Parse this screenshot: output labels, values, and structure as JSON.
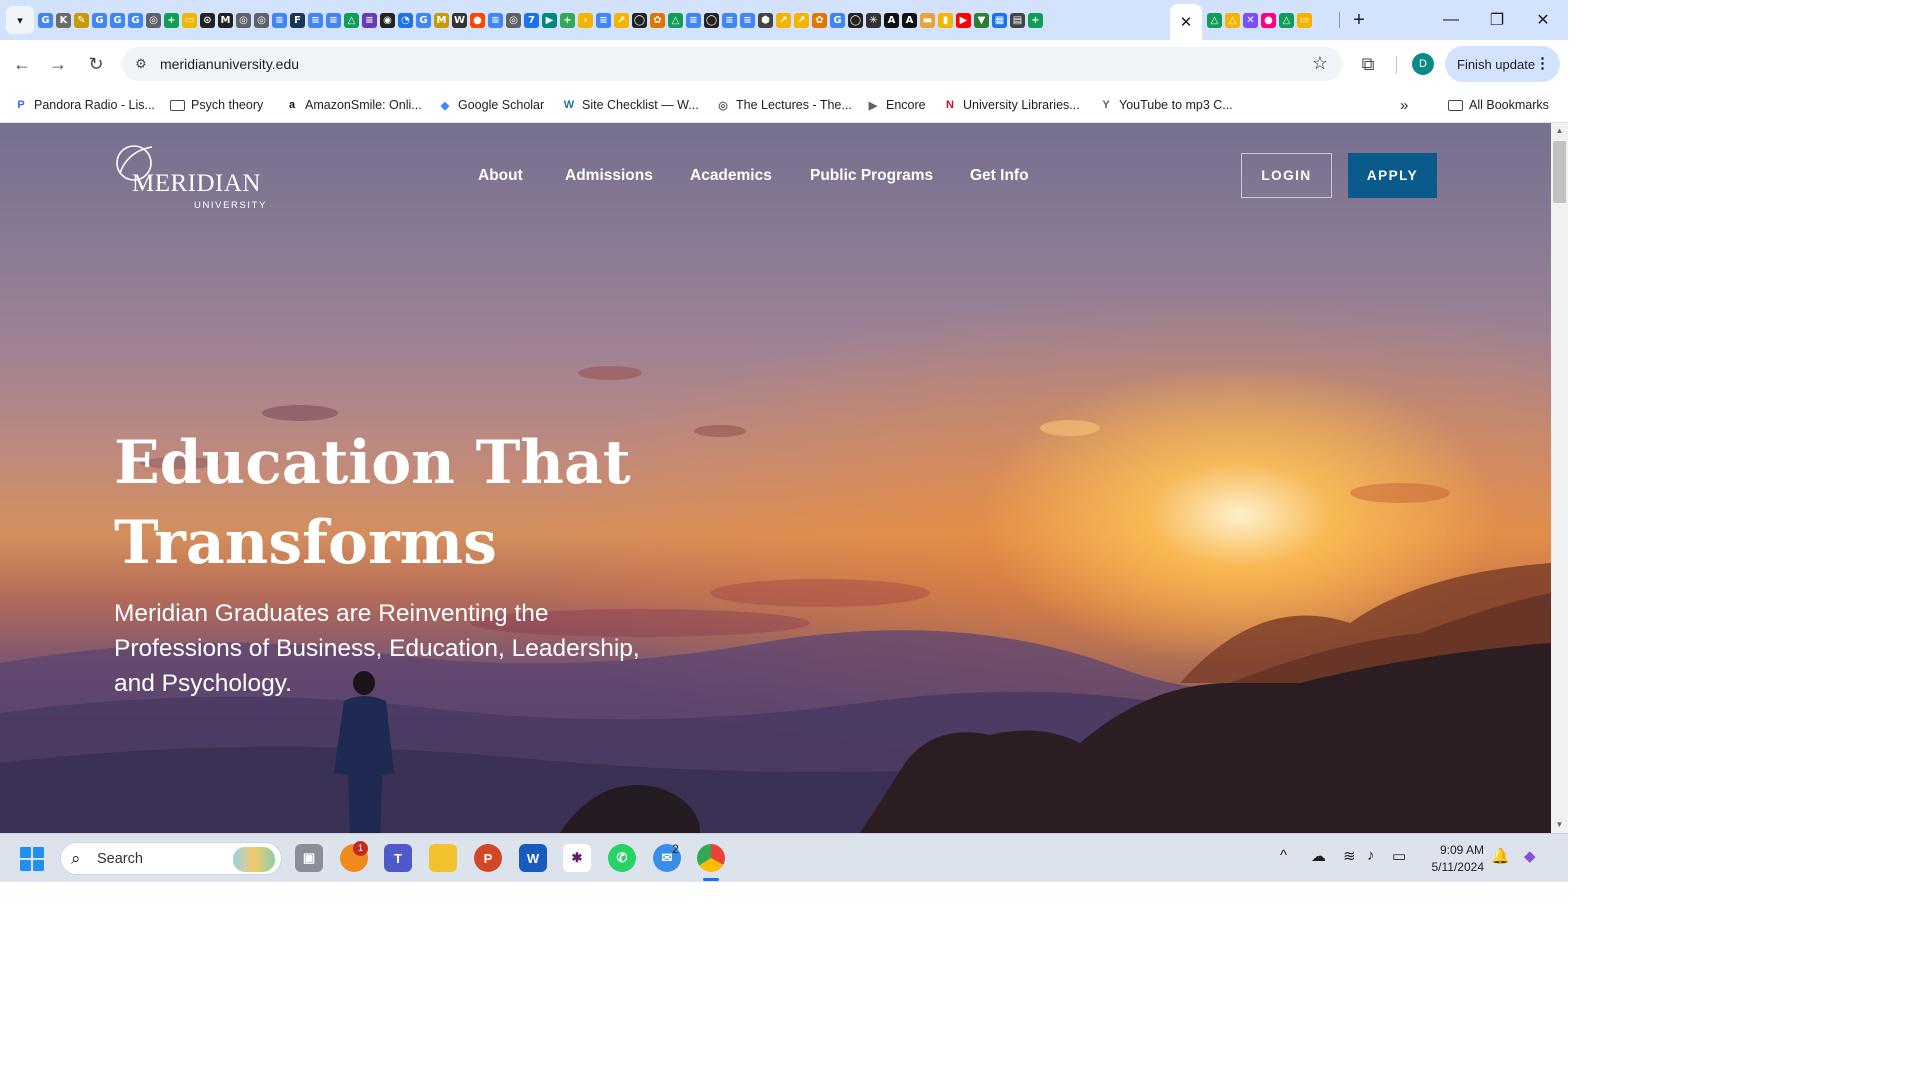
{
  "browser": {
    "url": "meridianuniversity.edu",
    "finish_update_label": "Finish update",
    "profile_initial": "D",
    "close_tab_glyph": "✕",
    "new_tab_glyph": "+",
    "window_controls": {
      "minimize": "—",
      "restore": "❐",
      "close": "✕"
    }
  },
  "tab_favicons": [
    {
      "icon": "google-icon",
      "color": "#4285f4",
      "glyph": "G"
    },
    {
      "icon": "doc-icon",
      "color": "#6b6b6b",
      "glyph": "K"
    },
    {
      "icon": "pencil-icon",
      "color": "#c79a0a",
      "glyph": "✎"
    },
    {
      "icon": "google-icon",
      "color": "#4285f4",
      "glyph": "G"
    },
    {
      "icon": "google-icon",
      "color": "#4285f4",
      "glyph": "G"
    },
    {
      "icon": "google-icon",
      "color": "#4285f4",
      "glyph": "G"
    },
    {
      "icon": "globe-icon",
      "color": "#5f6368",
      "glyph": "◎"
    },
    {
      "icon": "sheets-icon",
      "color": "#0f9d58",
      "glyph": "+"
    },
    {
      "icon": "slides-icon",
      "color": "#f4b400",
      "glyph": "▭"
    },
    {
      "icon": "app-icon",
      "color": "#222222",
      "glyph": "⊙"
    },
    {
      "icon": "app-icon",
      "color": "#222222",
      "glyph": "M"
    },
    {
      "icon": "globe-icon",
      "color": "#5f6368",
      "glyph": "◎"
    },
    {
      "icon": "globe-icon",
      "color": "#5f6368",
      "glyph": "◎"
    },
    {
      "icon": "docs-icon",
      "color": "#4285f4",
      "glyph": "≡"
    },
    {
      "icon": "app-icon",
      "color": "#1d3557",
      "glyph": "F"
    },
    {
      "icon": "docs-icon",
      "color": "#4285f4",
      "glyph": "≡"
    },
    {
      "icon": "docs-icon",
      "color": "#4285f4",
      "glyph": "≡"
    },
    {
      "icon": "drive-icon",
      "color": "#0f9d58",
      "glyph": "△"
    },
    {
      "icon": "forms-icon",
      "color": "#673ab7",
      "glyph": "≡"
    },
    {
      "icon": "app-icon",
      "color": "#222222",
      "glyph": "◉"
    },
    {
      "icon": "app-icon",
      "color": "#1a73e8",
      "glyph": "◔"
    },
    {
      "icon": "google-icon",
      "color": "#4285f4",
      "glyph": "G"
    },
    {
      "icon": "app-icon",
      "color": "#c79a0a",
      "glyph": "M"
    },
    {
      "icon": "wikipedia-icon",
      "color": "#333333",
      "glyph": "W"
    },
    {
      "icon": "reddit-icon",
      "color": "#ff4500",
      "glyph": "●"
    },
    {
      "icon": "docs-icon",
      "color": "#4285f4",
      "glyph": "≡"
    },
    {
      "icon": "globe-icon",
      "color": "#5f6368",
      "glyph": "◎"
    },
    {
      "icon": "calendar-icon",
      "color": "#1a73e8",
      "glyph": "7"
    },
    {
      "icon": "meet-icon",
      "color": "#00897b",
      "glyph": "▶"
    },
    {
      "icon": "plus-icon",
      "color": "#34a853",
      "glyph": "+"
    },
    {
      "icon": "app-icon",
      "color": "#f4b400",
      "glyph": "›"
    },
    {
      "icon": "docs-icon",
      "color": "#4285f4",
      "glyph": "≡"
    },
    {
      "icon": "app-icon",
      "color": "#f4b400",
      "glyph": "↗"
    },
    {
      "icon": "github-icon",
      "color": "#222222",
      "glyph": "◯"
    },
    {
      "icon": "app-icon",
      "color": "#e37400",
      "glyph": "✿"
    },
    {
      "icon": "drive-icon",
      "color": "#0f9d58",
      "glyph": "△"
    },
    {
      "icon": "docs-icon",
      "color": "#4285f4",
      "glyph": "≡"
    },
    {
      "icon": "github-icon",
      "color": "#222222",
      "glyph": "◯"
    },
    {
      "icon": "docs-icon",
      "color": "#4285f4",
      "glyph": "≡"
    },
    {
      "icon": "docs-icon",
      "color": "#4285f4",
      "glyph": "≡"
    },
    {
      "icon": "app-icon",
      "color": "#444444",
      "glyph": "⬢"
    },
    {
      "icon": "app-icon",
      "color": "#f4b400",
      "glyph": "↗"
    },
    {
      "icon": "app-icon",
      "color": "#f4b400",
      "glyph": "↗"
    },
    {
      "icon": "app-icon",
      "color": "#e37400",
      "glyph": "✿"
    },
    {
      "icon": "google-icon",
      "color": "#4285f4",
      "glyph": "G"
    },
    {
      "icon": "github-icon",
      "color": "#222222",
      "glyph": "◯"
    },
    {
      "icon": "app-icon",
      "color": "#333333",
      "glyph": "✳"
    },
    {
      "icon": "text-icon",
      "color": "#111111",
      "glyph": "A"
    },
    {
      "icon": "text-icon",
      "color": "#111111",
      "glyph": "A"
    },
    {
      "icon": "app-icon",
      "color": "#e8a33d",
      "glyph": "▬"
    },
    {
      "icon": "app-icon",
      "color": "#f4b400",
      "glyph": "▮"
    },
    {
      "icon": "youtube-icon",
      "color": "#ff0000",
      "glyph": "▶"
    },
    {
      "icon": "app-icon",
      "color": "#2e7d32",
      "glyph": "▼"
    },
    {
      "icon": "app-icon",
      "color": "#1a73e8",
      "glyph": "▦"
    },
    {
      "icon": "file-icon",
      "color": "#444444",
      "glyph": "▤"
    },
    {
      "icon": "sheets-icon",
      "color": "#0f9d58",
      "glyph": "+"
    }
  ],
  "tab_favicons_after": [
    {
      "icon": "drive-icon",
      "color": "#0f9d58",
      "glyph": "△"
    },
    {
      "icon": "drive-icon",
      "color": "#f4b400",
      "glyph": "△"
    },
    {
      "icon": "app-icon",
      "color": "#7c4dff",
      "glyph": "✕"
    },
    {
      "icon": "flickr-icon",
      "color": "#ff0084",
      "glyph": "●"
    },
    {
      "icon": "drive-icon",
      "color": "#0f9d58",
      "glyph": "△"
    },
    {
      "icon": "slides-icon",
      "color": "#f4b400",
      "glyph": "▭"
    }
  ],
  "bookmarks": [
    {
      "label": "Pandora Radio - Lis...",
      "icon": "pandora-icon",
      "color": "#3668ff",
      "glyph": "P"
    },
    {
      "label": "Psych theory",
      "icon": "folder-icon"
    },
    {
      "label": "AmazonSmile: Onli...",
      "icon": "amazon-icon",
      "color": "#111111",
      "glyph": "a"
    },
    {
      "label": "Google Scholar",
      "icon": "scholar-icon",
      "color": "#4285f4",
      "glyph": "◆"
    },
    {
      "label": "Site Checklist — W...",
      "icon": "wordpress-icon",
      "color": "#21759b",
      "glyph": "W"
    },
    {
      "label": "The Lectures - The...",
      "icon": "globe-icon",
      "color": "#5f6368",
      "glyph": "◎"
    },
    {
      "label": "Encore",
      "icon": "play-icon",
      "color": "#5f6368",
      "glyph": "▶"
    },
    {
      "label": "University Libraries...",
      "icon": "niu-icon",
      "color": "#c8102e",
      "glyph": "N"
    },
    {
      "label": "YouTube to mp3 C...",
      "icon": "ytmp3-icon",
      "color": "#5f6368",
      "glyph": "Y"
    }
  ],
  "all_bookmarks_label": "All Bookmarks",
  "site": {
    "logo_word": "MERIDIAN",
    "logo_sub": "UNIVERSITY",
    "nav": [
      "About",
      "Admissions",
      "Academics",
      "Public Programs",
      "Get Info"
    ],
    "login_label": "LOGIN",
    "apply_label": "APPLY",
    "hero_title": "Education That Transforms",
    "hero_subtitle": "Meridian Graduates are Reinventing the Professions of Business, Education, Leadership, and Psychology."
  },
  "taskbar": {
    "search_label": "Search",
    "firefox_badge": "1",
    "mail_badge": "2",
    "time": "9:09 AM",
    "date": "5/11/2024"
  },
  "colors": {
    "apply_button": "#0b5a8c",
    "tabstrip": "#d3e3fd",
    "taskbar": "#dde3ec"
  }
}
